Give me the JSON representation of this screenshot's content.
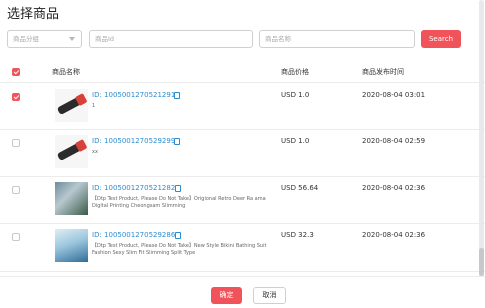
{
  "title": "选择商品",
  "filters": {
    "category_placeholder": "商品分组",
    "id_placeholder": "商品Id",
    "name_placeholder": "商品名称",
    "search_label": "Search"
  },
  "table": {
    "headers": {
      "name": "商品名称",
      "price": "商品价格",
      "time": "商品发布时间"
    },
    "rows": [
      {
        "checked": true,
        "id": "ID: 1005001270521291",
        "desc": "1",
        "price": "USD 1.0",
        "time": "2020-08-04 03:01"
      },
      {
        "checked": false,
        "id": "ID: 1005001270529299",
        "desc": "xx",
        "price": "USD 1.0",
        "time": "2020-08-04 02:59"
      },
      {
        "checked": false,
        "id": "ID: 1005001270521282",
        "desc": "【Dtp Test Product, Please Do Not Take】Origional Retro Deer Ra ama Digital Printing Cheongsam Slimming",
        "price": "USD 56.64",
        "time": "2020-08-04 02:36"
      },
      {
        "checked": false,
        "id": "ID: 1005001270529286",
        "desc": "【Dtp Test Product, Please Do Not Take】New Style Bikini Bathing Suit Fashion Sexy Slim Fit Slimming Split Type",
        "price": "USD 32.3",
        "time": "2020-08-04 02:36"
      }
    ]
  },
  "footer": {
    "confirm_label": "确定",
    "cancel_label": "取消"
  },
  "colors": {
    "accent": "#f0545a",
    "link": "#2d8ccf"
  }
}
